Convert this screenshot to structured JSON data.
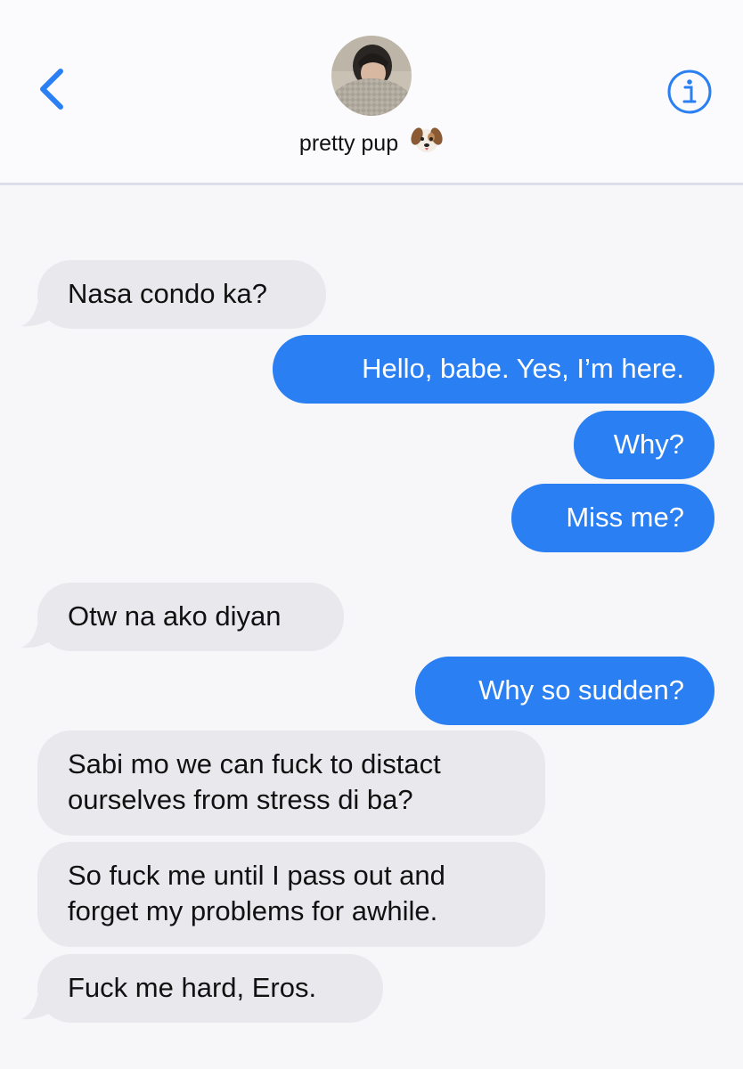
{
  "header": {
    "back_icon": "chevron-left-icon",
    "contact_name": "pretty pup",
    "contact_emoji": "dog-face-emoji",
    "info_icon": "info-circle-icon",
    "accent_color": "#2a7ff2"
  },
  "messages": [
    {
      "direction": "received",
      "text": "Nasa condo ka?",
      "tail": true
    },
    {
      "direction": "sent",
      "text": "Hello, babe. Yes, I’m here.",
      "tail": false
    },
    {
      "direction": "sent",
      "text": "Why?",
      "tail": false
    },
    {
      "direction": "sent",
      "text": "Miss me?",
      "tail": false
    },
    {
      "direction": "received",
      "text": "Otw na ako diyan",
      "tail": true
    },
    {
      "direction": "sent",
      "text": "Why so sudden?",
      "tail": false
    },
    {
      "direction": "received",
      "text": "Sabi mo we can fuck to distact ourselves from stress di ba?",
      "tail": false
    },
    {
      "direction": "received",
      "text": "So fuck me until I pass out and forget my problems for awhile.",
      "tail": false
    },
    {
      "direction": "received",
      "text": "Fuck me hard, Eros.",
      "tail": true
    }
  ],
  "colors": {
    "sent_bubble": "#2a7ff2",
    "received_bubble": "#e9e9ed",
    "background": "#f7f7fa"
  }
}
